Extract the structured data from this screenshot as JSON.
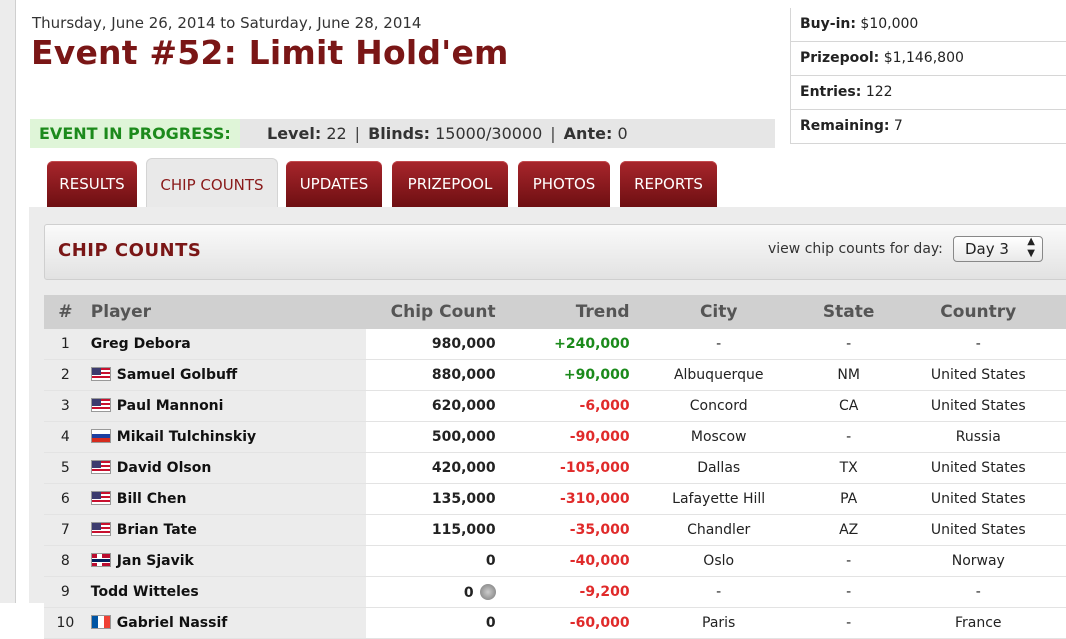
{
  "event": {
    "date_range": "Thursday, June 26, 2014 to Saturday, June 28, 2014",
    "title": "Event #52: Limit Hold'em"
  },
  "info": {
    "buyin_label": "Buy-in:",
    "buyin_value": "$10,000",
    "prizepool_label": "Prizepool:",
    "prizepool_value": "$1,146,800",
    "entries_label": "Entries:",
    "entries_value": "122",
    "remaining_label": "Remaining:",
    "remaining_value": "7"
  },
  "status": {
    "live_label": "EVENT IN PROGRESS:",
    "level_label": "Level:",
    "level_value": "22",
    "blinds_label": "Blinds:",
    "blinds_value": "15000/30000",
    "ante_label": "Ante:",
    "ante_value": "0"
  },
  "tabs": [
    {
      "label": "RESULTS"
    },
    {
      "label": "CHIP COUNTS",
      "active": true
    },
    {
      "label": "UPDATES"
    },
    {
      "label": "PRIZEPOOL"
    },
    {
      "label": "PHOTOS"
    },
    {
      "label": "REPORTS"
    }
  ],
  "chip_counts": {
    "title": "CHIP COUNTS",
    "day_label": "view chip counts for day:",
    "day_value": "Day 3",
    "columns": [
      "#",
      "Player",
      "Chip Count",
      "Trend",
      "City",
      "State",
      "Country"
    ],
    "rows": [
      {
        "rank": "1",
        "player": "Greg Debora",
        "flag": "",
        "chips": "980,000",
        "trend": "+240,000",
        "trend_sign": "pos",
        "city": "-",
        "state": "-",
        "country": "-"
      },
      {
        "rank": "2",
        "player": "Samuel Golbuff",
        "flag": "us",
        "chips": "880,000",
        "trend": "+90,000",
        "trend_sign": "pos",
        "city": "Albuquerque",
        "state": "NM",
        "country": "United States"
      },
      {
        "rank": "3",
        "player": "Paul Mannoni",
        "flag": "us",
        "chips": "620,000",
        "trend": "-6,000",
        "trend_sign": "neg",
        "city": "Concord",
        "state": "CA",
        "country": "United States"
      },
      {
        "rank": "4",
        "player": "Mikail Tulchinskiy",
        "flag": "ru",
        "chips": "500,000",
        "trend": "-90,000",
        "trend_sign": "neg",
        "city": "Moscow",
        "state": "-",
        "country": "Russia"
      },
      {
        "rank": "5",
        "player": "David Olson",
        "flag": "us",
        "chips": "420,000",
        "trend": "-105,000",
        "trend_sign": "neg",
        "city": "Dallas",
        "state": "TX",
        "country": "United States"
      },
      {
        "rank": "6",
        "player": "Bill Chen",
        "flag": "us",
        "chips": "135,000",
        "trend": "-310,000",
        "trend_sign": "neg",
        "city": "Lafayette Hill",
        "state": "PA",
        "country": "United States"
      },
      {
        "rank": "7",
        "player": "Brian Tate",
        "flag": "us",
        "chips": "115,000",
        "trend": "-35,000",
        "trend_sign": "neg",
        "city": "Chandler",
        "state": "AZ",
        "country": "United States"
      },
      {
        "rank": "8",
        "player": "Jan Sjavik",
        "flag": "no",
        "chips": "0",
        "trend": "-40,000",
        "trend_sign": "neg",
        "city": "Oslo",
        "state": "-",
        "country": "Norway"
      },
      {
        "rank": "9",
        "player": "Todd Witteles",
        "flag": "",
        "chips": "0",
        "chips_icon": true,
        "trend": "-9,200",
        "trend_sign": "neg",
        "city": "-",
        "state": "-",
        "country": "-"
      },
      {
        "rank": "10",
        "player": "Gabriel Nassif",
        "flag": "fr",
        "chips": "0",
        "trend": "-60,000",
        "trend_sign": "neg",
        "city": "Paris",
        "state": "-",
        "country": "France"
      }
    ]
  }
}
